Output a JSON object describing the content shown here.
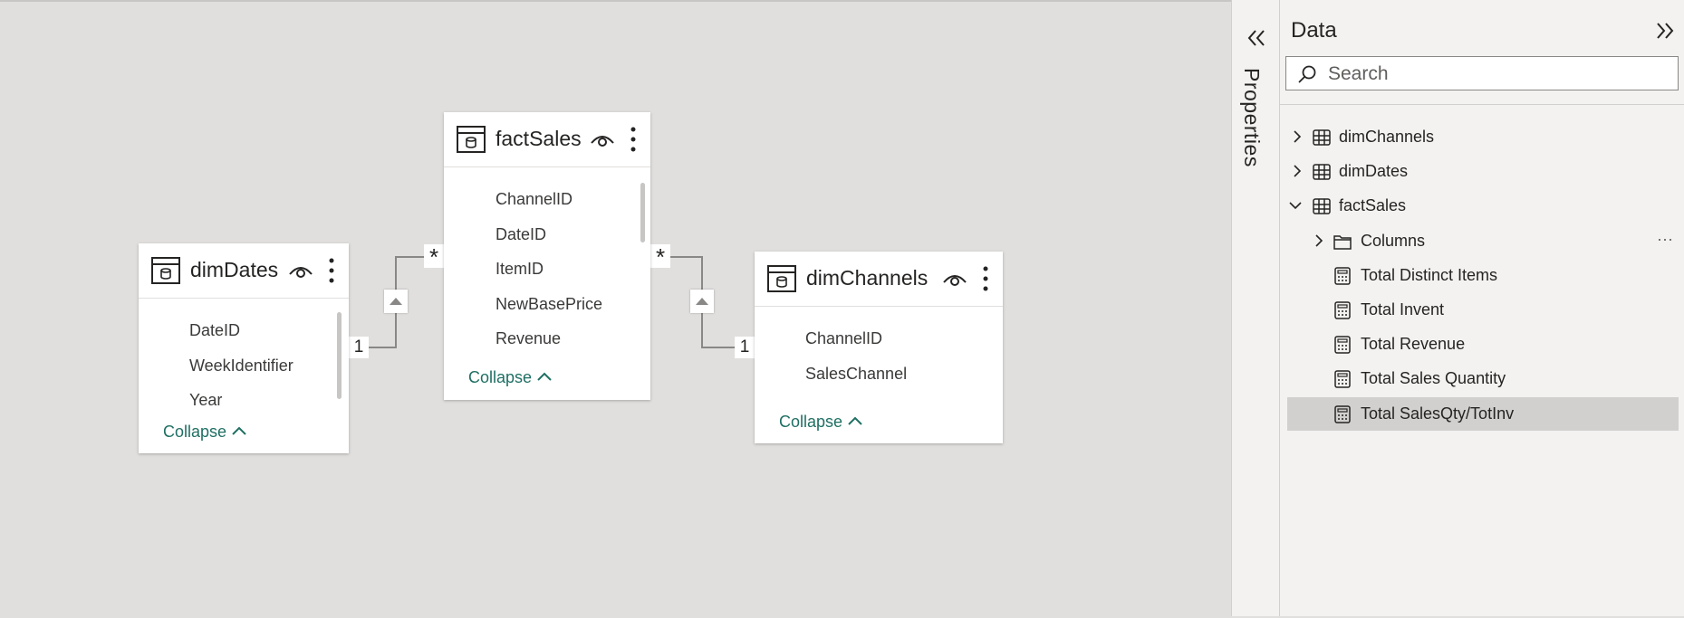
{
  "diagram": {
    "tables": [
      {
        "name": "dimDates",
        "fields": [
          "DateID",
          "WeekIdentifier",
          "Year"
        ],
        "collapse_label": "Collapse"
      },
      {
        "name": "factSales",
        "fields": [
          "ChannelID",
          "DateID",
          "ItemID",
          "NewBasePrice",
          "Revenue"
        ],
        "collapse_label": "Collapse"
      },
      {
        "name": "dimChannels",
        "fields": [
          "ChannelID",
          "SalesChannel"
        ],
        "collapse_label": "Collapse"
      }
    ],
    "relationships": [
      {
        "from": "factSales",
        "to": "dimDates",
        "many": "*",
        "one": "1"
      },
      {
        "from": "factSales",
        "to": "dimChannels",
        "many": "*",
        "one": "1"
      }
    ]
  },
  "properties_pane": {
    "label": "Properties"
  },
  "data_pane": {
    "title": "Data",
    "search_placeholder": "Search",
    "tree": [
      {
        "label": "dimChannels",
        "icon": "table-icon",
        "expanded": false
      },
      {
        "label": "dimDates",
        "icon": "table-icon",
        "expanded": false
      },
      {
        "label": "factSales",
        "icon": "table-icon",
        "expanded": true
      },
      {
        "label": "Columns",
        "icon": "folder-icon",
        "expanded": false
      },
      {
        "label": "Total Distinct Items",
        "icon": "measure-icon"
      },
      {
        "label": "Total Invent",
        "icon": "measure-icon"
      },
      {
        "label": "Total Revenue",
        "icon": "measure-icon"
      },
      {
        "label": "Total Sales Quantity",
        "icon": "measure-icon"
      },
      {
        "label": "Total SalesQty/TotInv",
        "icon": "measure-icon",
        "selected": true
      }
    ],
    "more_label": "···"
  },
  "colors": {
    "accent": "#1f6f63",
    "canvas": "#e1dfdd",
    "panel": "#f3f2f1",
    "selected": "#d2d0ce"
  }
}
